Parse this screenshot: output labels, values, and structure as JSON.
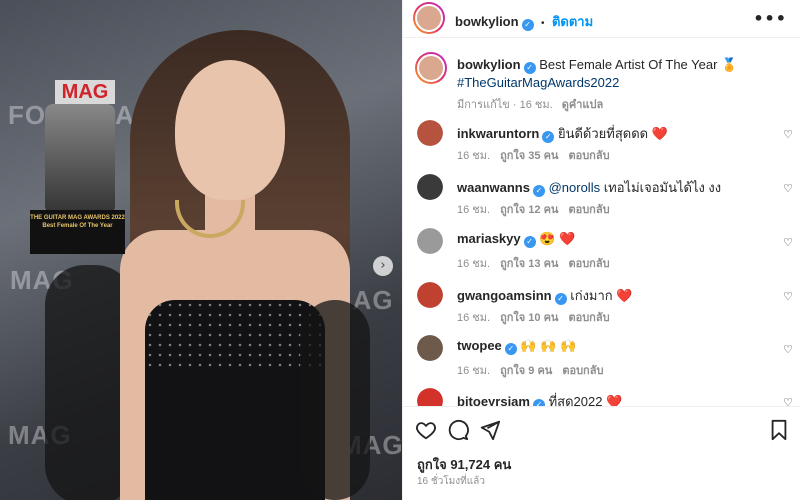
{
  "post": {
    "username": "bowkylion",
    "follow_label": "ติดตาม",
    "dot": "•",
    "more_label": "•••"
  },
  "caption": {
    "username": "bowkylion",
    "text": "Best Female Artist Of The Year 🏅",
    "hashtag": "#TheGuitarMagAwards2022",
    "edited": "มีการแก้ไข · 16 ชม.",
    "see_translation": "ดูคำแปล"
  },
  "photo": {
    "trophy_logo": "MAG",
    "trophy_plaque": "THE GUITAR MAG AWARDS 2022 Best Female Of The Year",
    "backdrop": [
      "FOR",
      "MAG",
      "AL",
      "MAG",
      "MAG",
      "MAG"
    ]
  },
  "comments": [
    {
      "username": "inkwaruntorn",
      "text": "ยินดีด้วยที่สุดดด ❤️",
      "time": "16 ชม.",
      "likes": "ถูกใจ 35 คน",
      "reply": "ตอบกลับ",
      "avatar_color": "#b5533f"
    },
    {
      "username": "waanwanns",
      "text": "@norolls เทอไม่เจอมันได้ไง งง",
      "time": "16 ชม.",
      "likes": "ถูกใจ 12 คน",
      "reply": "ตอบกลับ",
      "avatar_color": "#3a3a3a"
    },
    {
      "username": "mariaskyy",
      "text": "😍 ❤️",
      "time": "16 ชม.",
      "likes": "ถูกใจ 13 คน",
      "reply": "ตอบกลับ",
      "avatar_color": "#9a9a9a"
    },
    {
      "username": "gwangoamsinn",
      "text": "เก่งมาก ❤️",
      "time": "16 ชม.",
      "likes": "ถูกใจ 10 คน",
      "reply": "ตอบกลับ",
      "avatar_color": "#c0412f"
    },
    {
      "username": "twopee",
      "text": "🙌 🙌 🙌",
      "time": "16 ชม.",
      "likes": "ถูกใจ 9 คน",
      "reply": "ตอบกลับ",
      "avatar_color": "#6d5a4a"
    },
    {
      "username": "bitoeyrsiam",
      "text": "ที่สุด2022 ❤️",
      "time": "",
      "likes": "",
      "reply": "",
      "avatar_color": "#d2322a"
    }
  ],
  "actions": {
    "likes": "ถูกใจ 91,724 คน",
    "ago": "16 ชั่วโมงที่แล้ว"
  },
  "icons": {
    "heart": "heart-icon",
    "comment": "comment-icon",
    "share": "share-icon",
    "save": "bookmark-icon"
  },
  "colors": {
    "accent": "#0095f6",
    "verified": "#3897f0",
    "hashtag": "#00376b",
    "muted": "#8e8e8e",
    "red": "#ed4956"
  }
}
